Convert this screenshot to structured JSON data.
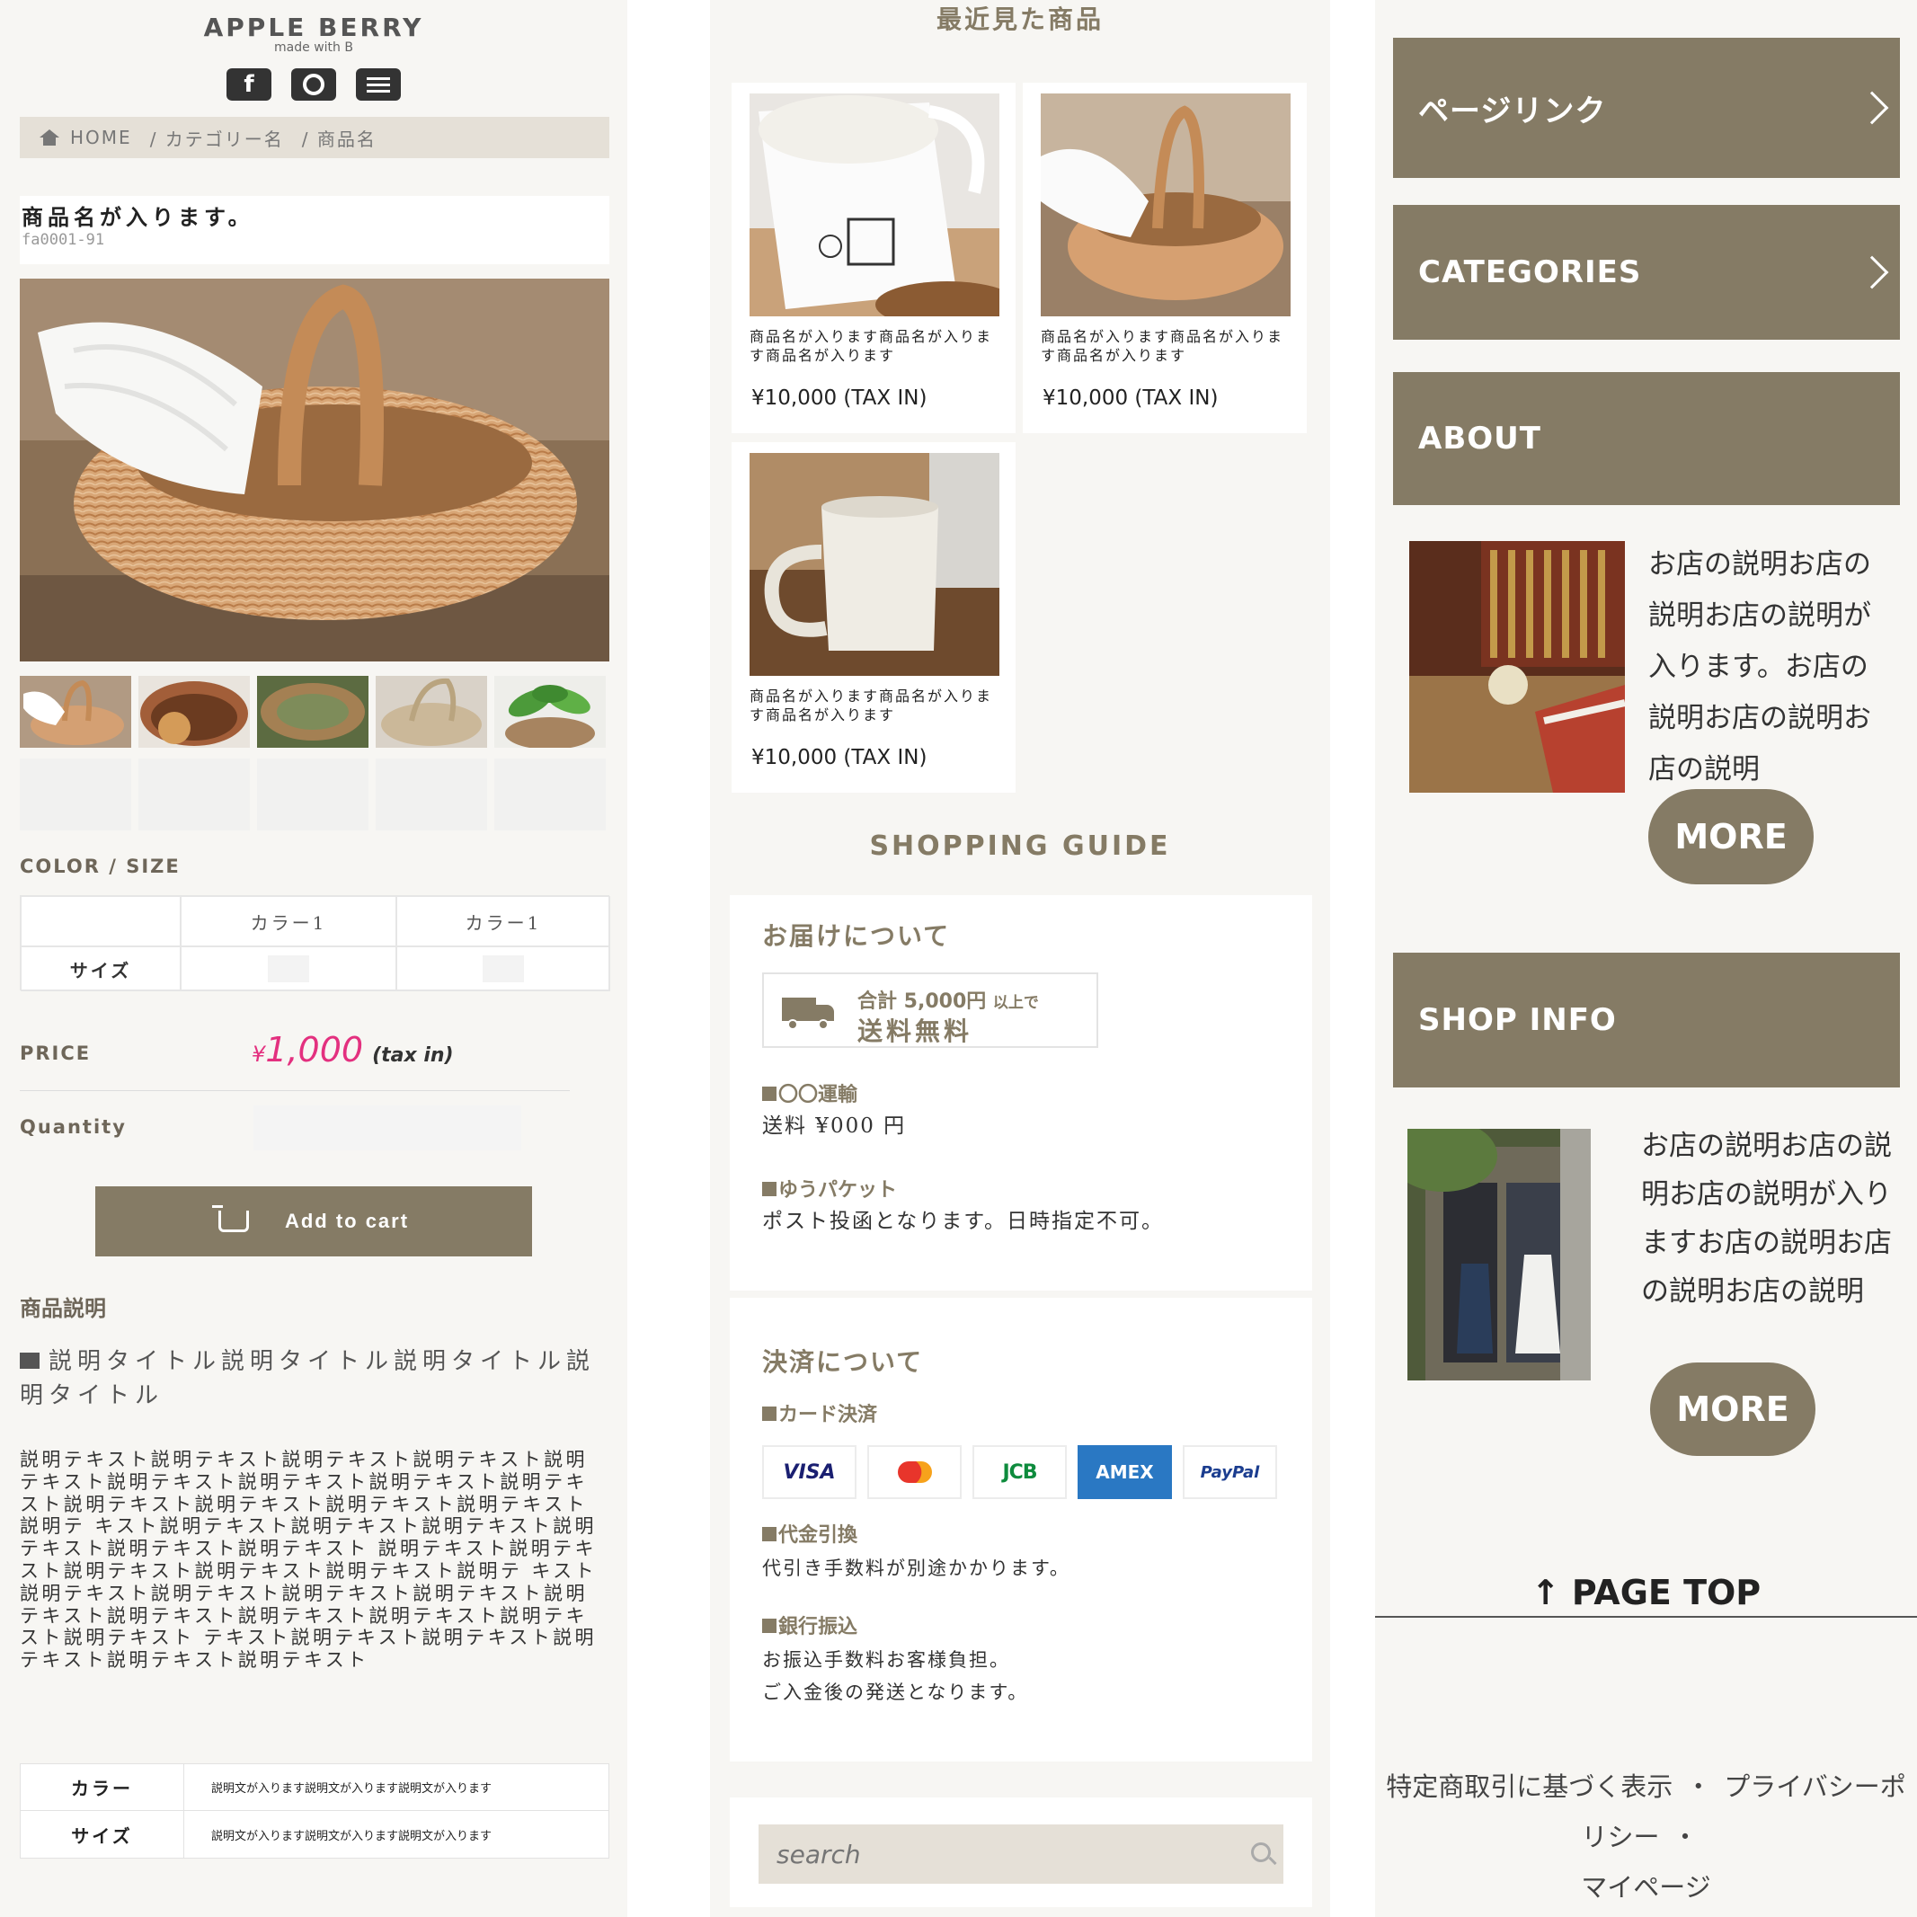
{
  "header": {
    "brand": "APPLE BERRY",
    "tagline": "made with B"
  },
  "social": [
    "facebook-icon",
    "instagram-icon",
    "blog-icon"
  ],
  "breadcrumb": {
    "home": "HOME",
    "category": "/ カテゴリー名",
    "product": "/ 商品名"
  },
  "product": {
    "title": "商品名が入ります。",
    "code": "fa0001-91",
    "color_size_label": "COLOR / SIZE",
    "color_headers": [
      "カラー1",
      "カラー1"
    ],
    "size_label": "サイズ",
    "price_label": "PRICE",
    "price_symbol": "¥",
    "price_amount": "1,000",
    "price_tax": "(tax in)",
    "quantity_label": "Quantity",
    "add_to_cart": "Add to cart",
    "description_heading": "商品説明",
    "description_title": "説明タイトル説明タイトル説明タイトル説明タイトル",
    "description_text": "説明テキスト説明テキスト説明テキスト説明テキスト説明テキスト説明テキスト説明テキスト説明テキスト説明テキスト説明テキスト説明テキスト説明テキスト説明テキスト説明テ キスト説明テキスト説明テキスト説明テキスト説明テキスト説明テキスト説明テキスト 説明テキスト説明テキスト説明テキスト説明テキスト説明テキスト説明テ キスト説明テキスト説明テキスト説明テキスト説明テキスト説明 テキスト説明テキスト説明テキスト説明テキスト説明テキスト説明テキスト テキスト説明テキスト説明テキスト説明テキスト説明テキスト説明テキスト",
    "specs": [
      {
        "key": "カラー",
        "value": "説明文が入ります説明文が入ります説明文が入ります"
      },
      {
        "key": "サイズ",
        "value": "説明文が入ります説明文が入ります説明文が入ります"
      }
    ]
  },
  "recent": {
    "heading": "最近見た商品",
    "items": [
      {
        "name": "商品名が入ります商品名が入ります商品名が入ります",
        "price": "¥10,000 (TAX IN)"
      },
      {
        "name": "商品名が入ります商品名が入ります商品名が入ります",
        "price": "¥10,000 (TAX IN)"
      },
      {
        "name": "商品名が入ります商品名が入ります商品名が入ります",
        "price": "¥10,000 (TAX IN)"
      }
    ]
  },
  "guide": {
    "heading": "SHOPPING GUIDE",
    "delivery": {
      "title": "お届けについて",
      "free_line1_a": "合計 5,000円",
      "free_line1_b": "以上で",
      "free_line2": "送料無料",
      "items": [
        {
          "label": "〇〇運輸",
          "text": "送料 ¥000 円"
        },
        {
          "label": "ゆうパケット",
          "text": "ポスト投函となります。日時指定不可。"
        }
      ]
    },
    "payment": {
      "title": "決済について",
      "card_label": "カード決済",
      "cards": [
        "VISA",
        "",
        "JCB",
        "AMEX",
        "PayPal"
      ],
      "cod_label": "代金引換",
      "cod_text": "代引き手数料が別途かかります。",
      "bank_label": "銀行振込",
      "bank_text1": "お振込手数料お客様負担。",
      "bank_text2": "ご入金後の発送となります。"
    }
  },
  "search": {
    "placeholder": "search"
  },
  "sidebar": {
    "page_link": "ページリンク",
    "categories": "CATEGORIES",
    "about": "ABOUT",
    "about_text": "お店の説明お店の説明お店の説明が入ります。お店の説明お店の説明お店の説明",
    "more": "MORE",
    "shop_info": "SHOP INFO",
    "shop_text": "お店の説明お店の説明お店の説明が入りますお店の説明お店の説明お店の説明"
  },
  "footer": {
    "page_top": "PAGE TOP",
    "links": [
      "特定商取引に基づく表示",
      "プライバシーポリシー",
      "マイページ"
    ]
  },
  "colors": {
    "accent": "#857b65",
    "price": "#e3307f",
    "bar": "#e5e0d7"
  }
}
